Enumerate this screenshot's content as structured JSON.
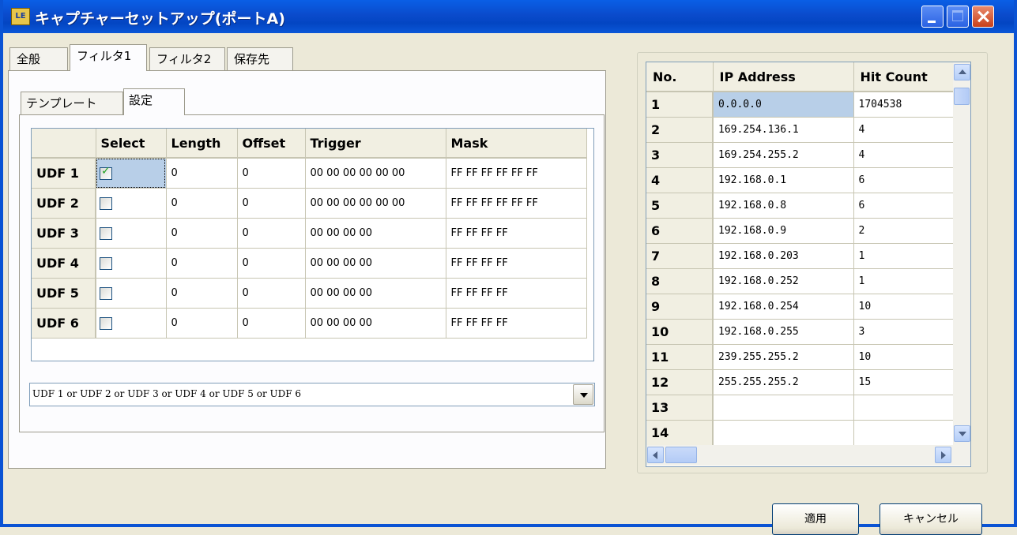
{
  "window": {
    "title": "キャプチャーセットアップ(ポートA)",
    "icon": "app-logo-icon",
    "icon_text": "LE"
  },
  "tabs": [
    {
      "label": "全般"
    },
    {
      "label": "フィルタ1",
      "active": true
    },
    {
      "label": "フィルタ2"
    },
    {
      "label": "保存先"
    }
  ],
  "subtabs": [
    {
      "label": "テンプレート"
    },
    {
      "label": "設定",
      "active": true
    }
  ],
  "udf_table": {
    "columns": [
      "",
      "Select",
      "Length",
      "Offset",
      "Trigger",
      "Mask"
    ],
    "rows": [
      {
        "name": "UDF 1",
        "selected": true,
        "length": "0",
        "offset": "0",
        "trigger": "00 00 00 00 00 00",
        "mask": "FF FF FF FF FF FF"
      },
      {
        "name": "UDF 2",
        "selected": false,
        "length": "0",
        "offset": "0",
        "trigger": "00 00 00 00 00 00",
        "mask": "FF FF FF FF FF FF"
      },
      {
        "name": "UDF 3",
        "selected": false,
        "length": "0",
        "offset": "0",
        "trigger": "00 00 00 00",
        "mask": "FF FF FF FF"
      },
      {
        "name": "UDF 4",
        "selected": false,
        "length": "0",
        "offset": "0",
        "trigger": "00 00 00 00",
        "mask": "FF FF FF FF"
      },
      {
        "name": "UDF 5",
        "selected": false,
        "length": "0",
        "offset": "0",
        "trigger": "00 00 00 00",
        "mask": "FF FF FF FF"
      },
      {
        "name": "UDF 6",
        "selected": false,
        "length": "0",
        "offset": "0",
        "trigger": "00 00 00 00",
        "mask": "FF FF FF FF"
      }
    ]
  },
  "condition": {
    "value": "UDF 1 or UDF 2 or UDF 3 or UDF 4 or UDF 5 or UDF 6"
  },
  "ip_table": {
    "columns": [
      "No.",
      "IP Address",
      "Hit Count"
    ],
    "rows": [
      {
        "no": "1",
        "ip": "0.0.0.0",
        "hits": "1704538"
      },
      {
        "no": "2",
        "ip": "169.254.136.1",
        "hits": "4"
      },
      {
        "no": "3",
        "ip": "169.254.255.2",
        "hits": "4"
      },
      {
        "no": "4",
        "ip": "192.168.0.1",
        "hits": "6"
      },
      {
        "no": "5",
        "ip": "192.168.0.8",
        "hits": "6"
      },
      {
        "no": "6",
        "ip": "192.168.0.9",
        "hits": "2"
      },
      {
        "no": "7",
        "ip": "192.168.0.203",
        "hits": "1"
      },
      {
        "no": "8",
        "ip": "192.168.0.252",
        "hits": "1"
      },
      {
        "no": "9",
        "ip": "192.168.0.254",
        "hits": "10"
      },
      {
        "no": "10",
        "ip": "192.168.0.255",
        "hits": "3"
      },
      {
        "no": "11",
        "ip": "239.255.255.2",
        "hits": "10"
      },
      {
        "no": "12",
        "ip": "255.255.255.2",
        "hits": "15"
      },
      {
        "no": "13",
        "ip": "",
        "hits": ""
      },
      {
        "no": "14",
        "ip": "",
        "hits": ""
      }
    ]
  },
  "buttons": {
    "apply": "適用",
    "cancel": "キャンセル"
  }
}
